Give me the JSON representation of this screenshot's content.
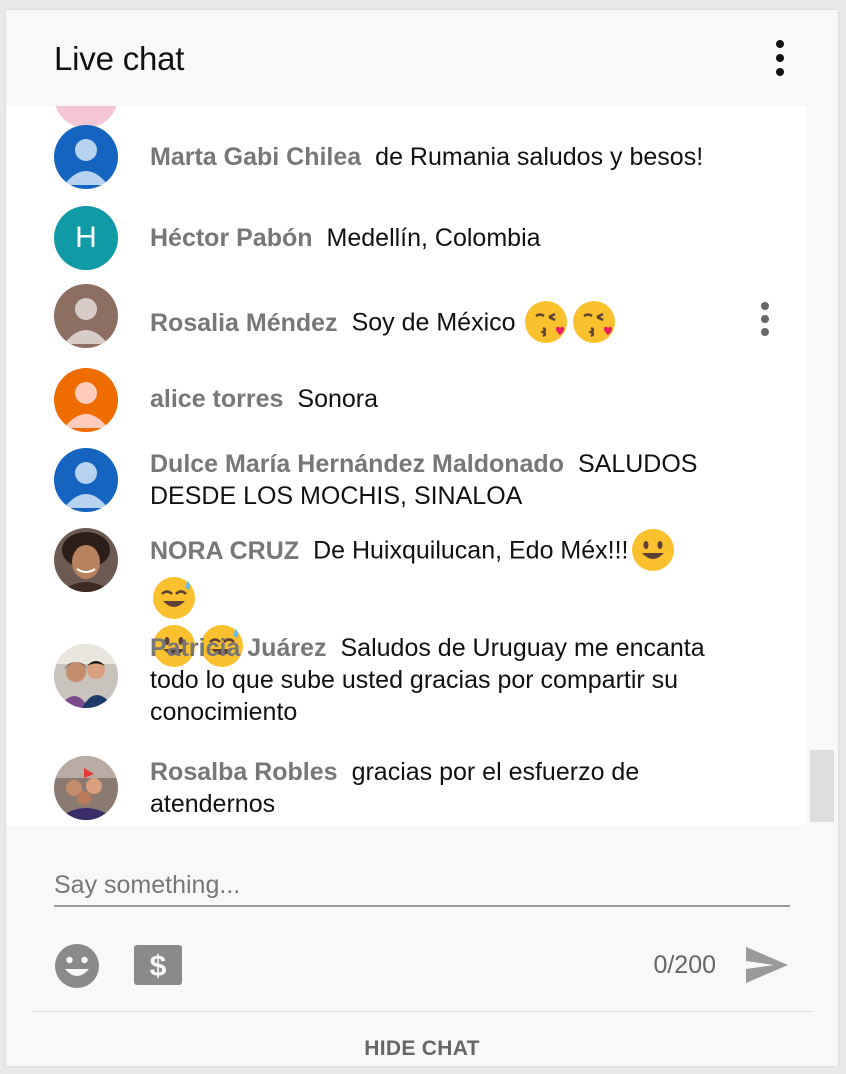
{
  "header": {
    "title": "Live chat",
    "menu_icon": "more-vert-icon"
  },
  "messages": [
    {
      "author": "Marta Gabi Chilea",
      "text": "de Rumania saludos y besos!",
      "avatar": "default-person-blue"
    },
    {
      "author": "Héctor Pabón",
      "text": "Medellín, Colombia",
      "avatar": "letter-teal",
      "initial": "H"
    },
    {
      "author": "Rosalia Méndez",
      "text": "Soy de México",
      "emojis": [
        "kissing-heart",
        "kissing-heart"
      ],
      "avatar": "default-person-brown",
      "hover_menu": true
    },
    {
      "author": "alice torres",
      "text": "Sonora",
      "avatar": "default-person-orange"
    },
    {
      "author": "Dulce María Hernández Maldonado",
      "text": "SALUDOS DESDE LOS MOCHIS, SINALOA",
      "avatar": "default-person-blue"
    },
    {
      "author": "NORA CRUZ",
      "text": "De Huixquilucan, Edo Méx!!!",
      "emojis": [
        "smile",
        "sweat-smile",
        "smile",
        "sweat-smile"
      ],
      "avatar": "photo-woman"
    },
    {
      "author": "Patricia Juárez",
      "text": "Saludos de Uruguay me encanta todo lo que sube usted gracias por compartir su conocimiento",
      "avatar": "photo-couple"
    },
    {
      "author": "Rosalba Robles",
      "text": "gracias por el esfuerzo de atendernos",
      "avatar": "photo-group"
    }
  ],
  "footer": {
    "input_placeholder": "Say something...",
    "input_value": "",
    "char_counter": "0/200",
    "emoji_button_icon": "emoji-smile-icon",
    "superchat_icon": "dollar-icon",
    "send_icon": "send-icon",
    "hide_chat_label": "HIDE CHAT"
  },
  "colors": {
    "avatar_blue": "#1565c0",
    "avatar_teal": "#0f9aa5",
    "avatar_brown": "#8d6e63",
    "avatar_orange": "#ef6c00",
    "author_gray": "#777777",
    "panel_bg": "#f8f8f8"
  }
}
